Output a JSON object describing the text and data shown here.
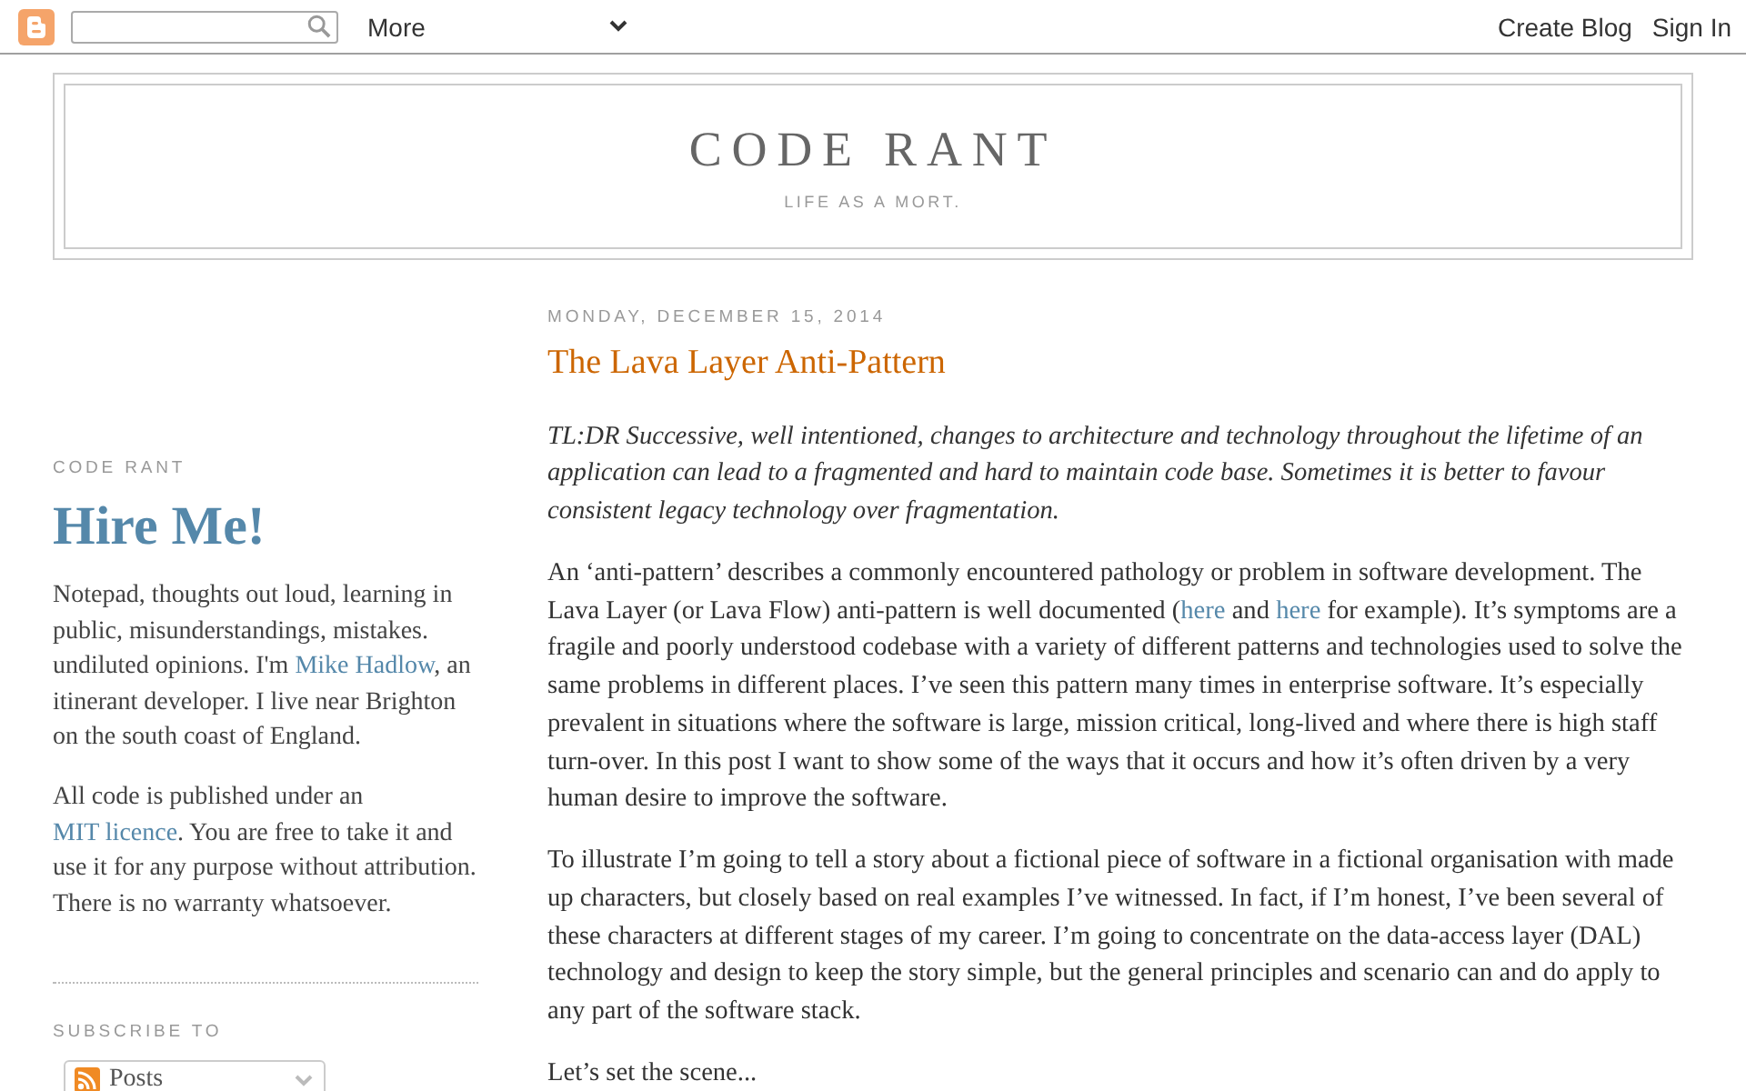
{
  "navbar": {
    "menu": {
      "label": "More"
    },
    "links": [
      "Create Blog",
      "Sign In"
    ]
  },
  "header": {
    "title": "CODE RANT",
    "description": "LIFE AS A MORT."
  },
  "sidebar": {
    "widgets": [
      {
        "kind": "text",
        "title": "CODE RANT",
        "heading": "Hire Me!",
        "paragraphs": [
          [
            {
              "kind": "text",
              "text": "Notepad, thoughts out loud, learning in public, misunderstandings, mistakes. undiluted opinions. I'm "
            },
            {
              "kind": "link",
              "text": "Mike Hadlow"
            },
            {
              "kind": "text",
              "text": ", an itinerant developer. I live near Brighton on the south coast of England."
            }
          ],
          [
            {
              "kind": "text",
              "text": "All code is published under an "
            },
            {
              "kind": "link",
              "text": "MIT licence"
            },
            {
              "kind": "text",
              "text": ". You are free to take it and use it for any purpose without attribution. There is no warranty whatsoever."
            }
          ]
        ]
      },
      {
        "kind": "subscribe",
        "title": "SUBSCRIBE TO",
        "dropdown": {
          "label": "Posts"
        }
      }
    ]
  },
  "post": {
    "date": "MONDAY, DECEMBER 15, 2014",
    "title": "The Lava Layer Anti-Pattern",
    "paragraphs": [
      {
        "kind": "summary",
        "segments": [
          {
            "kind": "text",
            "text": "TL:DR Successive, well intentioned, changes to architecture and technology throughout the lifetime of an application can lead to a fragmented and hard to maintain code base. Sometimes it is better to favour consistent legacy technology over fragmentation."
          }
        ]
      },
      {
        "kind": "body",
        "segments": [
          {
            "kind": "text",
            "text": "An ‘anti-pattern’ describes a commonly encountered pathology or problem in software development. The Lava Layer (or Lava Flow) anti-pattern is well documented ("
          },
          {
            "kind": "link",
            "text": "here"
          },
          {
            "kind": "text",
            "text": " and "
          },
          {
            "kind": "link",
            "text": "here"
          },
          {
            "kind": "text",
            "text": " for example). It’s symptoms are a fragile and poorly understood codebase with a variety of different patterns and technologies used to solve the same problems in different places. I’ve seen this pattern many times in enterprise software. It’s especially prevalent in situations where the software is large, mission critical, long-lived and where there is high staff turn-over. In this post I want to show some of the ways that it occurs and how it’s often driven by a very human desire to improve the software."
          }
        ]
      },
      {
        "kind": "body",
        "segments": [
          {
            "kind": "text",
            "text": "To illustrate I’m going to tell a story about a fictional piece of software in a fictional organisation with made up characters, but closely based on real examples I’ve witnessed. In fact, if I’m honest, I’ve been several of these characters at different stages of my career. I’m going to concentrate on the data-access layer (DAL) technology and design to keep the story simple, but the general principles and scenario can and do apply to any part of the software stack."
          }
        ]
      },
      {
        "kind": "body",
        "segments": [
          {
            "kind": "text",
            "text": "Let’s set the scene..."
          }
        ]
      }
    ]
  }
}
